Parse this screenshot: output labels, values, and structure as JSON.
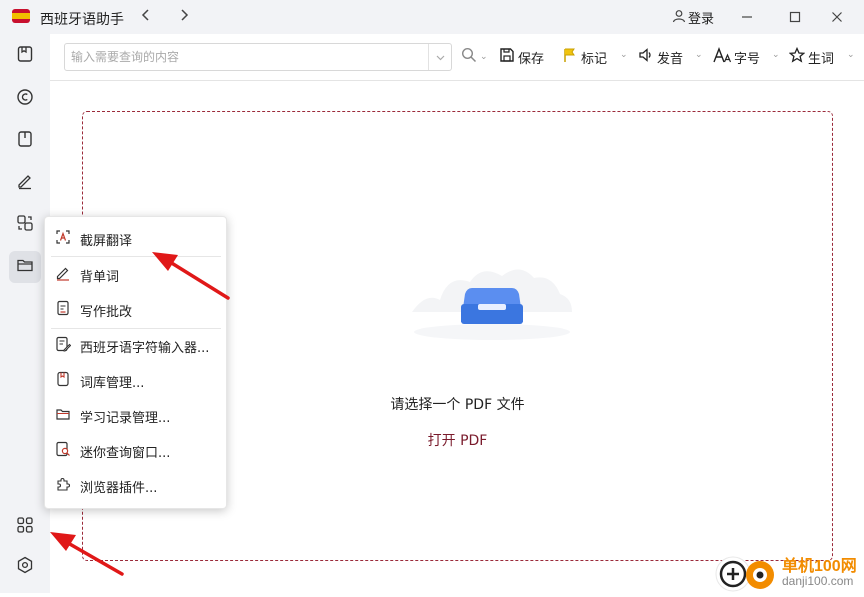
{
  "app": {
    "title": "西班牙语助手",
    "login_label": "登录"
  },
  "search": {
    "placeholder": "输入需要查询的内容"
  },
  "toolbar": {
    "save_label": "保存",
    "mark_label": "标记",
    "pronounce_label": "发音",
    "fontsize_label": "字号",
    "newwords_label": "生词"
  },
  "main": {
    "empty_message": "请选择一个 PDF 文件",
    "open_pdf_label": "打开 PDF"
  },
  "popup_menu": {
    "items": [
      {
        "label": "截屏翻译",
        "icon": "screenshot-translate-icon"
      },
      {
        "label": "背单词",
        "icon": "pencil-icon"
      },
      {
        "label": "写作批改",
        "icon": "writing-correction-icon"
      },
      {
        "label": "西班牙语字符输入器...",
        "icon": "char-input-icon"
      },
      {
        "label": "词库管理...",
        "icon": "bookmark-icon"
      },
      {
        "label": "学习记录管理...",
        "icon": "folder-icon"
      },
      {
        "label": "迷你查询窗口...",
        "icon": "mini-search-icon"
      },
      {
        "label": "浏览器插件...",
        "icon": "puzzle-icon"
      }
    ]
  },
  "watermark": {
    "name": "单机100网",
    "url": "danji100.com"
  },
  "colors": {
    "accent": "#7a1b2c",
    "dashed_border": "#9b2a3a",
    "arrow": "#e01818",
    "tray_blue": "#3b76e0"
  }
}
